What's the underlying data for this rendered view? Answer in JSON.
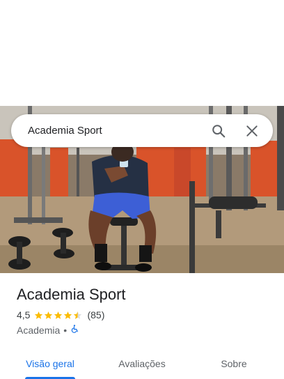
{
  "search": {
    "query": "Academia Sport"
  },
  "place": {
    "name": "Academia Sport",
    "rating": "4,5",
    "rating_value": 4.5,
    "rating_max": 5,
    "review_count": "(85)",
    "category": "Academia",
    "separator": "•",
    "accessibility_icon": "wheelchair-icon"
  },
  "tabs": [
    {
      "label": "Visão geral",
      "active": true
    },
    {
      "label": "Avaliações",
      "active": false
    },
    {
      "label": "Sobre",
      "active": false
    }
  ],
  "colors": {
    "accent": "#1a73e8",
    "star": "#fbbc04",
    "gym_wall": "#d9532a"
  }
}
